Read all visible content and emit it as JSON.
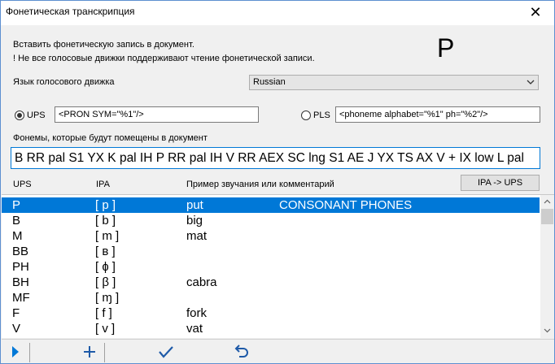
{
  "window": {
    "title": "Фонетическая транскрипция",
    "close_glyph": "✕"
  },
  "info": {
    "line1": "Вставить фонетическую запись в документ.",
    "line2": "! Не все голосовые движки поддерживают чтение фонетической записи.",
    "big_phone": "P"
  },
  "engine": {
    "label": "Язык голосового движка",
    "value": "Russian"
  },
  "format": {
    "ups_label": "UPS",
    "ups_selected": true,
    "ups_template": "<PRON SYM=\"%1\"/>",
    "pls_label": "PLS",
    "pls_selected": false,
    "pls_template": "<phoneme alphabet=\"%1\" ph=\"%2\"/>"
  },
  "phonemes": {
    "label": "Фонемы, которые будут помещены в документ",
    "value": "B RR pal S1 YX K pal IH P RR pal IH V RR AEX SC lng S1 AE J YX TS AX V + IX low L pal"
  },
  "table": {
    "col_ups": "UPS",
    "col_ipa": "IPA",
    "col_example": "Пример звучания или комментарий",
    "convert_button": "IPA -> UPS",
    "rows": [
      {
        "ups": "P",
        "ipa": "[ p ]",
        "example": "put",
        "comment": "CONSONANT PHONES"
      },
      {
        "ups": "B",
        "ipa": "[ b ]",
        "example": "big",
        "comment": ""
      },
      {
        "ups": "M",
        "ipa": "[ m ]",
        "example": "mat",
        "comment": ""
      },
      {
        "ups": "BB",
        "ipa": "[ ʙ ]",
        "example": "",
        "comment": ""
      },
      {
        "ups": "PH",
        "ipa": "[ ɸ ]",
        "example": "",
        "comment": ""
      },
      {
        "ups": "BH",
        "ipa": "[ β ]",
        "example": "cabra",
        "comment": ""
      },
      {
        "ups": "MF",
        "ipa": "[ ɱ ]",
        "example": "",
        "comment": ""
      },
      {
        "ups": "F",
        "ipa": "[ f ]",
        "example": "fork",
        "comment": ""
      },
      {
        "ups": "V",
        "ipa": "[ v ]",
        "example": "vat",
        "comment": ""
      }
    ]
  },
  "toolbar": {
    "play_icon": "play-icon",
    "add_icon": "plus-icon",
    "ok_icon": "checkmark-icon",
    "undo_icon": "undo-icon",
    "accent": "#0078d7"
  }
}
